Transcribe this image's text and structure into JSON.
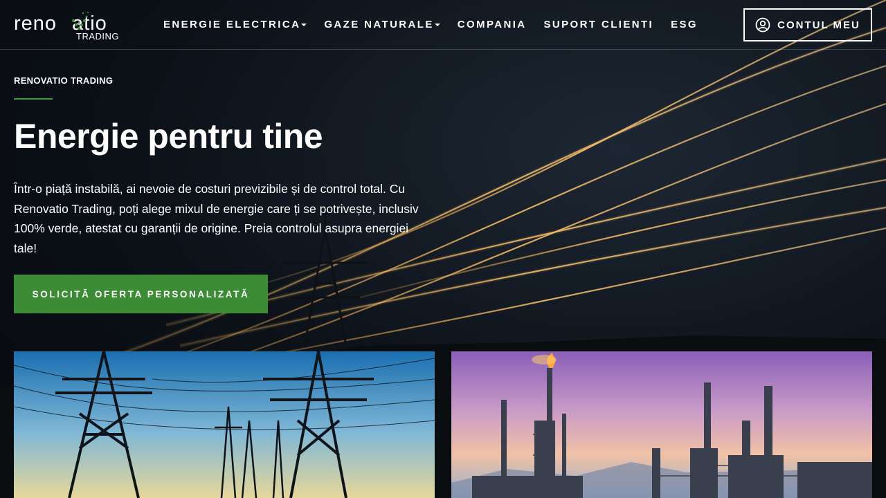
{
  "brand": {
    "word": "reno vatio",
    "sub": "TRADING",
    "accent": "#3b8c35"
  },
  "nav": {
    "items": [
      {
        "label": "ENERGIE ELECTRICA",
        "dropdown": true
      },
      {
        "label": "GAZE NATURALE",
        "dropdown": true
      },
      {
        "label": "COMPANIA",
        "dropdown": false
      },
      {
        "label": "SUPORT CLIENTI",
        "dropdown": false
      },
      {
        "label": "ESG",
        "dropdown": false
      }
    ],
    "account_label": "CONTUL MEU",
    "account_icon": "user-circle-icon"
  },
  "hero": {
    "eyebrow": "RENOVATIO TRADING",
    "headline": "Energie pentru tine",
    "lead": "Într-o piață instabilă, ai nevoie de costuri previzibile și de control total. Cu Renovatio Trading, poți alege mixul de energie care ți se potrivește, inclusiv 100% verde, atestat cu garanții de origine. Preia controlul asupra energiei tale!",
    "cta_label": "SOLICITĂ OFERTA PERSONALIZATĂ"
  },
  "cards": [
    {
      "image": "power-lines-photo"
    },
    {
      "image": "refinery-photo"
    }
  ]
}
